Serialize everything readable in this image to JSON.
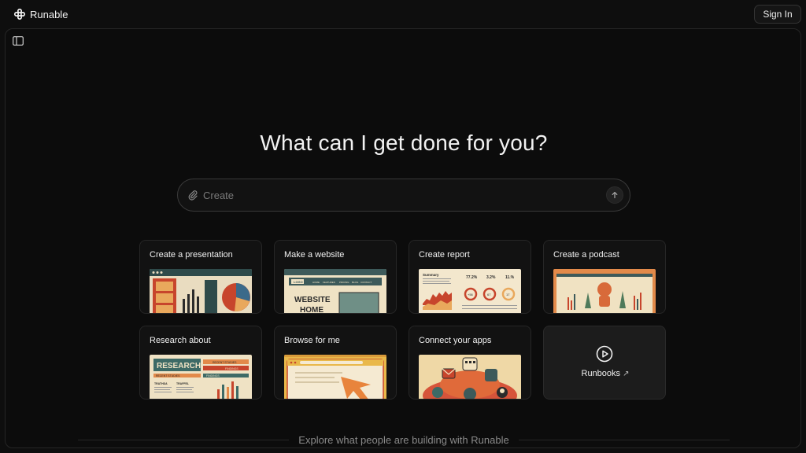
{
  "app": {
    "name": "Runable"
  },
  "header": {
    "signin_label": "Sign In"
  },
  "main": {
    "headline": "What can I get done for you?",
    "prompt": {
      "placeholder": "Create",
      "value": ""
    }
  },
  "cards": [
    {
      "title": "Create a presentation"
    },
    {
      "title": "Make a website",
      "thumb_text": {
        "logo": "LOGO",
        "nav": [
          "HOME",
          "FEATURES",
          "PRICING",
          "BLOG",
          "CONTACT"
        ],
        "hero1": "WEBSITE",
        "hero2": "HOME"
      }
    },
    {
      "title": "Create report",
      "thumb_text": {
        "summary": "Summary",
        "stats": [
          "77.2%",
          "3.2%",
          "11.%"
        ],
        "gauges": [
          "+56",
          "67",
          "17"
        ]
      }
    },
    {
      "title": "Create a podcast"
    },
    {
      "title": "Research about",
      "thumb_text": {
        "heading": "RESEARCH",
        "tag1": "RECENT STUDIES",
        "tag2": "FINDINGS",
        "tag3": "RECENT STUDIES",
        "tag4": "FINDINGS",
        "col1": "TRATHDA",
        "col2": "TRAFFEL"
      }
    },
    {
      "title": "Browse for me"
    },
    {
      "title": "Connect your apps"
    }
  ],
  "runbooks": {
    "label": "Runbooks",
    "arrow": "↗"
  },
  "footer": {
    "explore_text": "Explore what people are building with Runable"
  },
  "colors": {
    "background": "#0e0e0e",
    "card": "#121212",
    "border": "#262626",
    "text": "#f0f0f0",
    "muted": "#8a8a8a"
  }
}
